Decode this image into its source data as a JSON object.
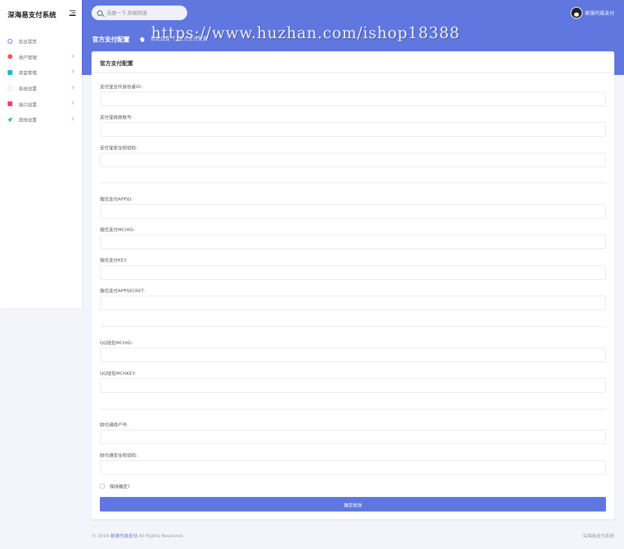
{
  "sidebar": {
    "brand": "深海易支付系统",
    "items": [
      {
        "label": "后台首页",
        "icon": "dashboard-icon",
        "color": "#5a78e0",
        "has_chevron": false
      },
      {
        "label": "商户管理",
        "icon": "user-icon",
        "color": "#ef5b5b",
        "has_chevron": true
      },
      {
        "label": "资金管理",
        "icon": "wallet-icon",
        "color": "#22b8cf",
        "has_chevron": true
      },
      {
        "label": "系统设置",
        "icon": "gear-icon",
        "color": "#f39aa8",
        "has_chevron": true
      },
      {
        "label": "接口设置",
        "icon": "plug-icon",
        "color": "#e84a6f",
        "has_chevron": true
      },
      {
        "label": "其他设置",
        "icon": "paper-plane-icon",
        "color": "#38c172",
        "has_chevron": true
      }
    ]
  },
  "header": {
    "search_placeholder": "百度一下,你就知道",
    "user_name": "新源代易支付",
    "page_title": "官方支付配置",
    "breadcrumbs": [
      "系统设置",
      "官方支付配置"
    ],
    "breadcrumb_sep": "/",
    "watermark": "https://www.huzhan.com/ishop18388"
  },
  "card": {
    "title": "官方支付配置",
    "fields": [
      {
        "label": "支付宝合作身份者ID:",
        "value": ""
      },
      {
        "label": "支付宝收款账号:",
        "value": ""
      },
      {
        "label": "支付宝安全校验码:",
        "value": ""
      },
      {
        "label": "微信支付APPID:",
        "value": ""
      },
      {
        "label": "微信支付MCHID:",
        "value": ""
      },
      {
        "label": "微信支付KEY:",
        "value": ""
      },
      {
        "label": "微信支付APPSECRET:",
        "value": ""
      },
      {
        "label": "QQ钱包MCHID:",
        "value": ""
      },
      {
        "label": "QQ钱包MCHKEY:",
        "value": ""
      },
      {
        "label": "财付通商户号:",
        "value": ""
      },
      {
        "label": "财付通安全校验码:",
        "value": ""
      }
    ],
    "remember_label": "保持确定?",
    "submit_label": "确定修改"
  },
  "footer": {
    "copyright_prefix": "© 2019",
    "brand_link": "新源代易支付",
    "copyright_suffix": "All Rights Reserved.",
    "right_text": "深海易支付系统"
  },
  "colors": {
    "accent": "#6077e0",
    "page_bg": "#f4f5fa"
  }
}
